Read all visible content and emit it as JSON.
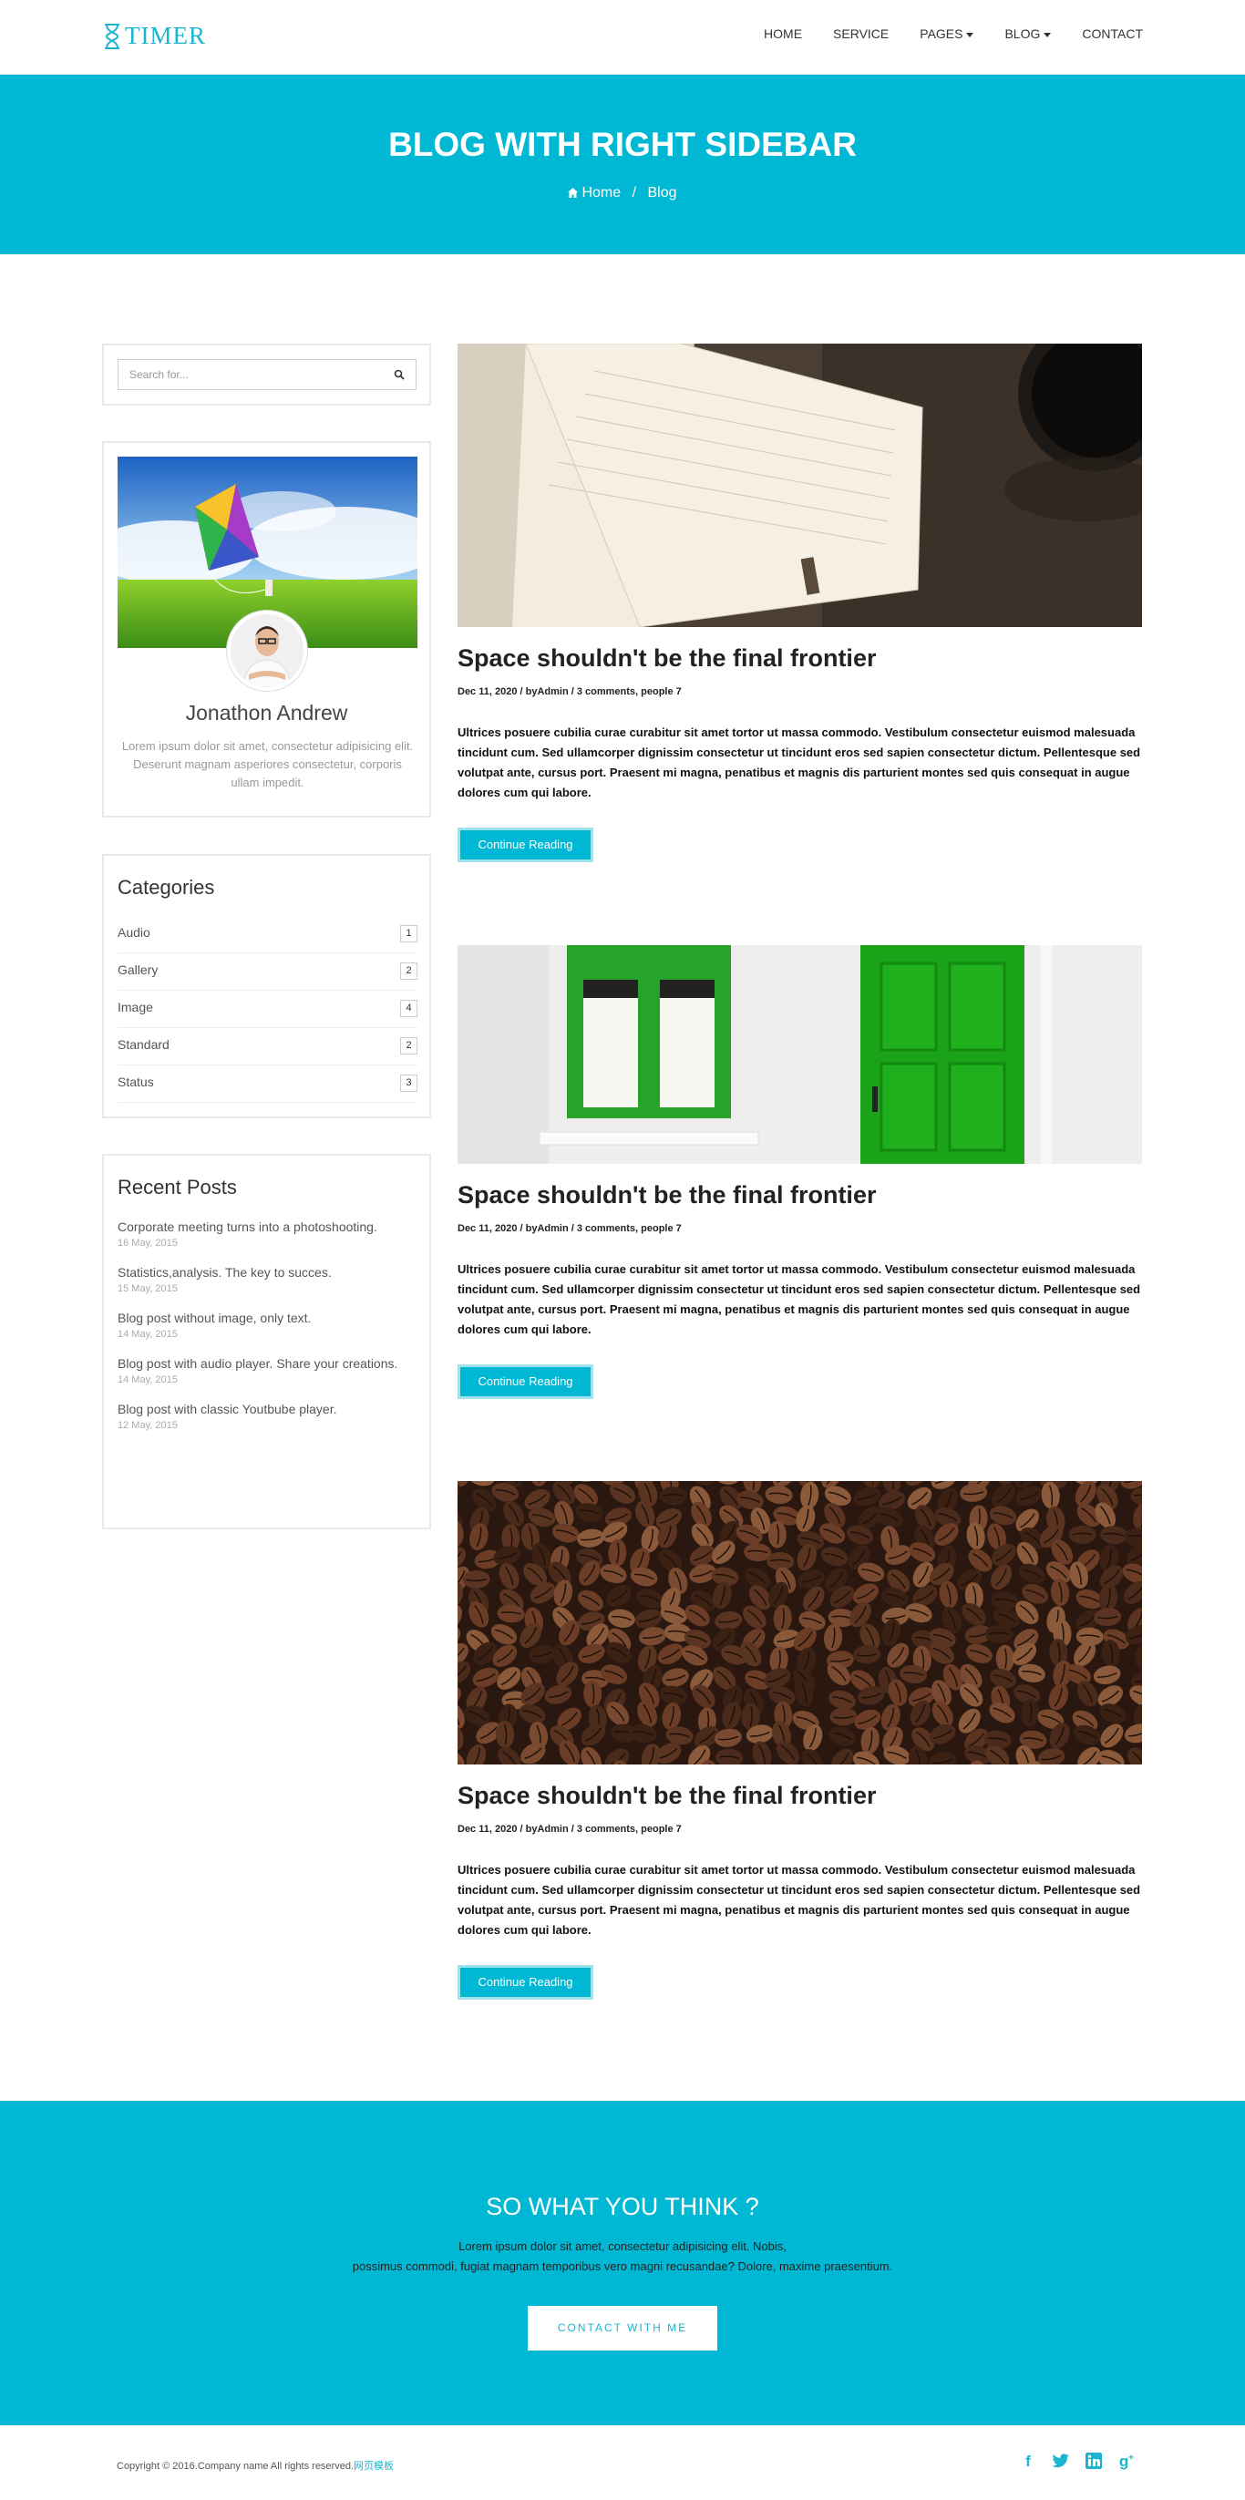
{
  "brand": {
    "logo_text": "TIMER",
    "accent_color": "#00b8d4"
  },
  "nav": {
    "items": [
      {
        "label": "HOME",
        "dropdown": false
      },
      {
        "label": "SERVICE",
        "dropdown": false
      },
      {
        "label": "PAGES",
        "dropdown": true
      },
      {
        "label": "BLOG",
        "dropdown": true
      },
      {
        "label": "CONTACT",
        "dropdown": false
      }
    ]
  },
  "hero": {
    "title": "BLOG WITH RIGHT SIDEBAR",
    "breadcrumb": {
      "home": "Home",
      "separator": "/",
      "current": "Blog"
    }
  },
  "sidebar": {
    "search": {
      "placeholder": "Search for..."
    },
    "profile": {
      "name": "Jonathon Andrew",
      "bio": "Lorem ipsum dolor sit amet, consectetur adipisicing elit. Deserunt magnam asperiores consectetur, corporis ullam impedit."
    },
    "categories": {
      "title": "Categories",
      "items": [
        {
          "label": "Audio",
          "count": "1"
        },
        {
          "label": "Gallery",
          "count": "2"
        },
        {
          "label": "Image",
          "count": "4"
        },
        {
          "label": "Standard",
          "count": "2"
        },
        {
          "label": "Status",
          "count": "3"
        }
      ]
    },
    "recent_posts": {
      "title": "Recent Posts",
      "items": [
        {
          "title": "Corporate meeting turns into a photoshooting.",
          "date": "16 May, 2015"
        },
        {
          "title": "Statistics,analysis. The key to succes.",
          "date": "15 May, 2015"
        },
        {
          "title": "Blog post without image, only text.",
          "date": "14 May, 2015"
        },
        {
          "title": "Blog post with audio player. Share your creations.",
          "date": "14 May, 2015"
        },
        {
          "title": "Blog post with classic Youtbube player.",
          "date": "12 May, 2015"
        }
      ]
    }
  },
  "posts": [
    {
      "title": "Space shouldn't be the final frontier",
      "meta": "Dec 11, 2020 / byAdmin / 3 comments, people 7",
      "excerpt": "Ultrices posuere cubilia curae curabitur sit amet tortor ut massa commodo. Vestibulum consectetur euismod malesuada tincidunt cum. Sed ullamcorper dignissim consectetur ut tincidunt eros sed sapien consectetur dictum. Pellentesque sed volutpat ante, cursus port. Praesent mi magna, penatibus et magnis dis parturient montes sed quis consequat in augue dolores cum qui labore.",
      "button": "Continue Reading"
    },
    {
      "title": "Space shouldn't be the final frontier",
      "meta": "Dec 11, 2020 / byAdmin / 3 comments, people 7",
      "excerpt": "Ultrices posuere cubilia curae curabitur sit amet tortor ut massa commodo. Vestibulum consectetur euismod malesuada tincidunt cum. Sed ullamcorper dignissim consectetur ut tincidunt eros sed sapien consectetur dictum. Pellentesque sed volutpat ante, cursus port. Praesent mi magna, penatibus et magnis dis parturient montes sed quis consequat in augue dolores cum qui labore.",
      "button": "Continue Reading"
    },
    {
      "title": "Space shouldn't be the final frontier",
      "meta": "Dec 11, 2020 / byAdmin / 3 comments, people 7",
      "excerpt": "Ultrices posuere cubilia curae curabitur sit amet tortor ut massa commodo. Vestibulum consectetur euismod malesuada tincidunt cum. Sed ullamcorper dignissim consectetur ut tincidunt eros sed sapien consectetur dictum. Pellentesque sed volutpat ante, cursus port. Praesent mi magna, penatibus et magnis dis parturient montes sed quis consequat in augue dolores cum qui labore.",
      "button": "Continue Reading"
    }
  ],
  "cta": {
    "title": "SO WHAT YOU THINK ?",
    "line1": "Lorem ipsum dolor sit amet, consectetur adipisicing elit. Nobis,",
    "line2": "possimus commodi, fugiat magnam temporibus vero magni recusandae? Dolore, maxime praesentium.",
    "button": "CONTACT WITH ME"
  },
  "footer": {
    "copyright": "Copyright © 2016.Company name All rights reserved.",
    "link": "网页模板",
    "social": [
      "facebook-icon",
      "twitter-icon",
      "linkedin-icon",
      "google-plus-icon"
    ]
  }
}
